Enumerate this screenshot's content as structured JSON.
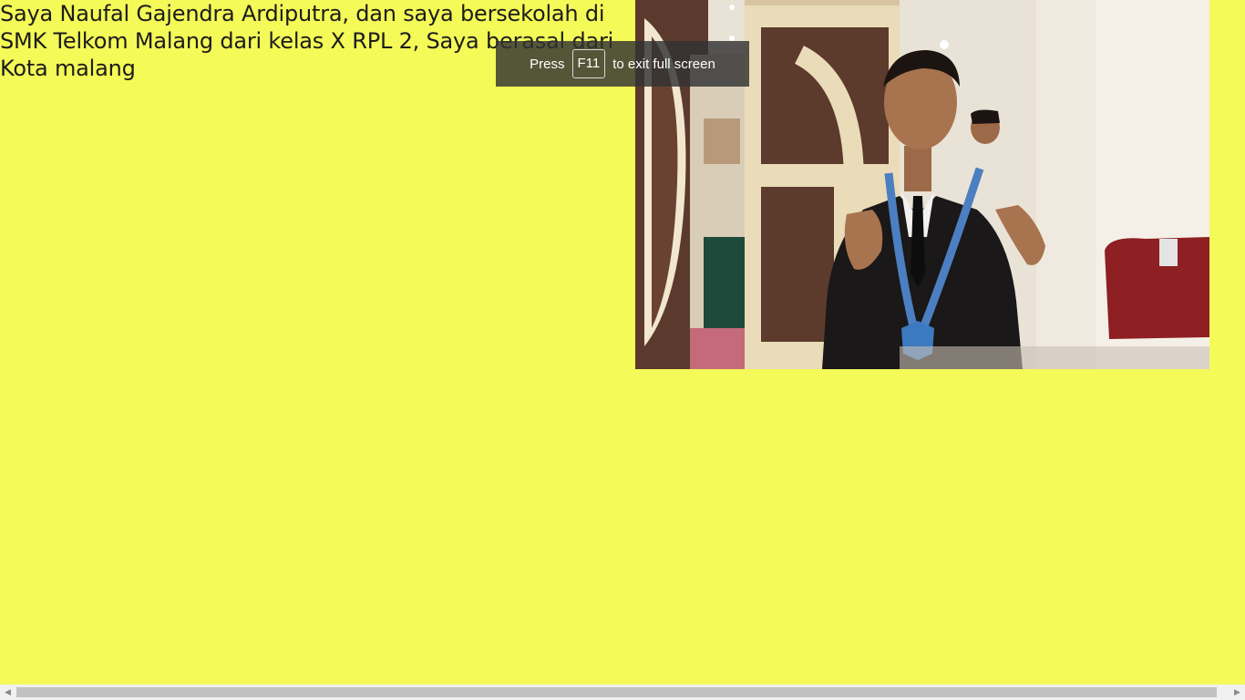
{
  "intro_text": "Saya Naufal Gajendra Ardiputra, dan saya bersekolah di SMK Telkom Malang dari kelas X RPL 2, Saya berasal dari Kota malang",
  "background_color": "#f4fa57",
  "photo": {
    "icon": "portrait-photo"
  },
  "fullscreen_notice": {
    "prefix": "Press",
    "key": "F11",
    "suffix": "to exit full screen"
  },
  "scrollbar": {
    "left_arrow": "◀",
    "right_arrow": "▶"
  }
}
